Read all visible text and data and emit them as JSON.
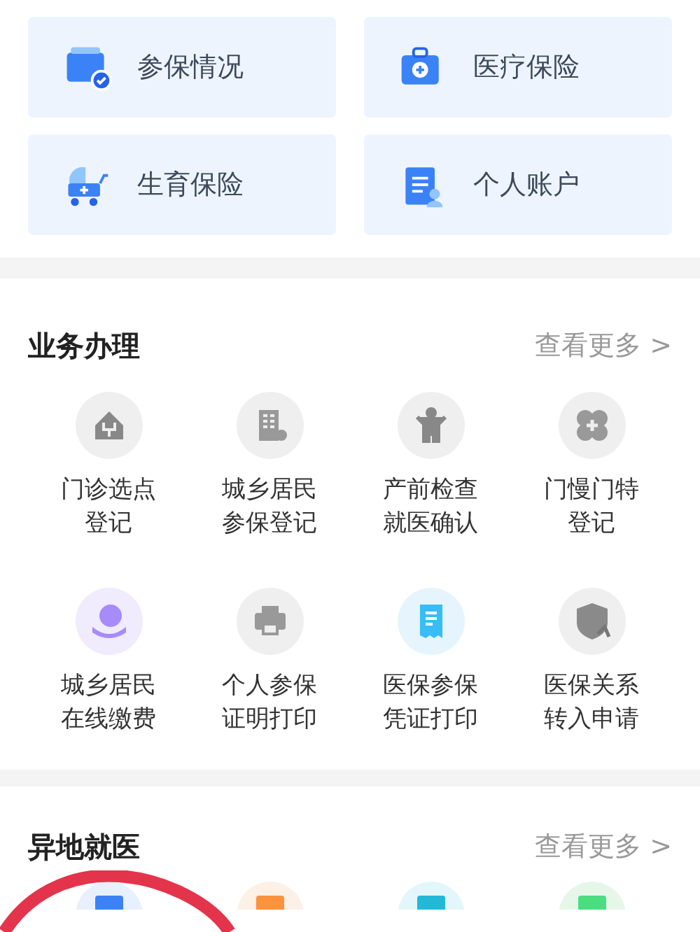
{
  "top_cards": [
    {
      "label": "参保情况"
    },
    {
      "label": "医疗保险"
    },
    {
      "label": "生育保险"
    },
    {
      "label": "个人账户"
    }
  ],
  "sections": [
    {
      "title": "业务办理",
      "more": "查看更多 >",
      "items": [
        {
          "label": "门诊选点登记"
        },
        {
          "label": "城乡居民参保登记"
        },
        {
          "label": "产前检查就医确认"
        },
        {
          "label": "门慢门特登记"
        },
        {
          "label": "城乡居民在线缴费"
        },
        {
          "label": "个人参保证明打印"
        },
        {
          "label": "医保参保凭证打印"
        },
        {
          "label": "医保关系转入申请"
        }
      ]
    },
    {
      "title": "异地就医",
      "more": "查看更多 >"
    }
  ]
}
